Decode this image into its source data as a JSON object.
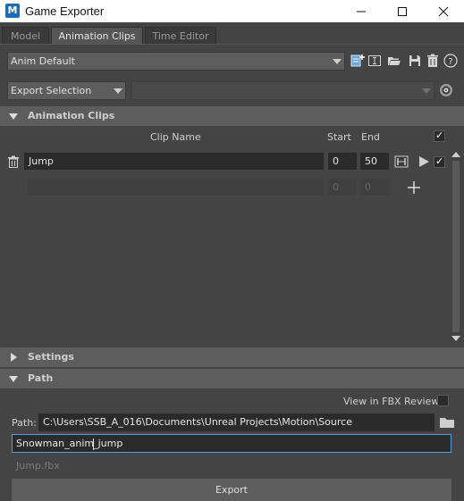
{
  "window": {
    "app_icon_letter": "M",
    "title": "Game Exporter"
  },
  "tabs": [
    {
      "label": "Model",
      "active": false
    },
    {
      "label": "Animation Clips",
      "active": true
    },
    {
      "label": "Time Editor",
      "active": false
    }
  ],
  "preset": {
    "selected": "Anim Default"
  },
  "export_mode": {
    "selected": "Export Selection",
    "secondary_selected": ""
  },
  "sections": {
    "animation_clips": {
      "label": "Animation Clips",
      "expanded": true
    },
    "settings": {
      "label": "Settings",
      "expanded": false
    },
    "path": {
      "label": "Path",
      "expanded": true
    }
  },
  "clips_table": {
    "headers": {
      "clip_name": "Clip Name",
      "start": "Start",
      "end": "End"
    },
    "select_all_checked": true,
    "rows": [
      {
        "name": "Jump",
        "start": "0",
        "end": "50",
        "checked": true
      }
    ],
    "new_row": {
      "name": "",
      "start": "0",
      "end": "0"
    }
  },
  "path_section": {
    "view_in_fbx_review_label": "View in FBX Review",
    "view_in_fbx_review_checked": false,
    "path_label": "Path:",
    "path_value": "C:\\Users\\SSB_A_016\\Documents\\Unreal Projects\\Motion\\Source",
    "filename_before_cursor": "Snowman_anim",
    "filename_after_cursor": "_jump",
    "output_file_preview": "Jump.fbx",
    "export_label": "Export"
  },
  "colors": {
    "panel_bg": "#444444",
    "header_bg": "#5d5d5d",
    "field_bg": "#2b2b2b",
    "focus_border": "#5a9ee0",
    "app_icon_blue": "#1b6cb8"
  }
}
